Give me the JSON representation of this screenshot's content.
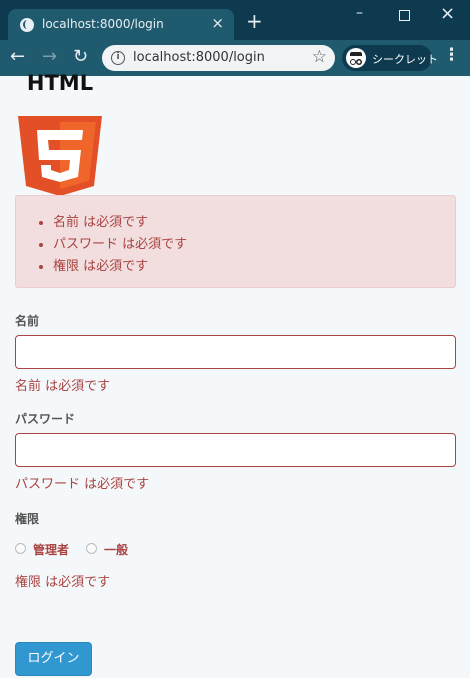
{
  "browser": {
    "tab_title": "localhost:8000/login",
    "tab_close": "×",
    "new_tab": "+",
    "window_min": "–",
    "window_close": "×",
    "nav_back": "←",
    "nav_forward": "→",
    "reload": "↻",
    "url": "localhost:8000/login",
    "incognito_label": "シークレット",
    "menu": "⋮",
    "star": "☆",
    "info": "i"
  },
  "logo": {
    "text": "HTML",
    "digit": "5"
  },
  "alert": {
    "errors": [
      "名前 は必須です",
      "パスワード は必須です",
      "権限 は必須です"
    ]
  },
  "form": {
    "name": {
      "label": "名前",
      "value": "",
      "error": "名前 は必須です"
    },
    "password": {
      "label": "パスワード",
      "value": "",
      "error": "パスワード は必須です"
    },
    "role": {
      "label": "権限",
      "options": [
        "管理者",
        "一般"
      ],
      "selected": null,
      "error": "権限 は必須です"
    },
    "submit_label": "ログイン"
  },
  "colors": {
    "error": "#a94442",
    "alert_bg": "#f2dede",
    "button": "#3097d1",
    "chrome": "#0e3a4f",
    "page_bg": "#f5f8fa"
  }
}
